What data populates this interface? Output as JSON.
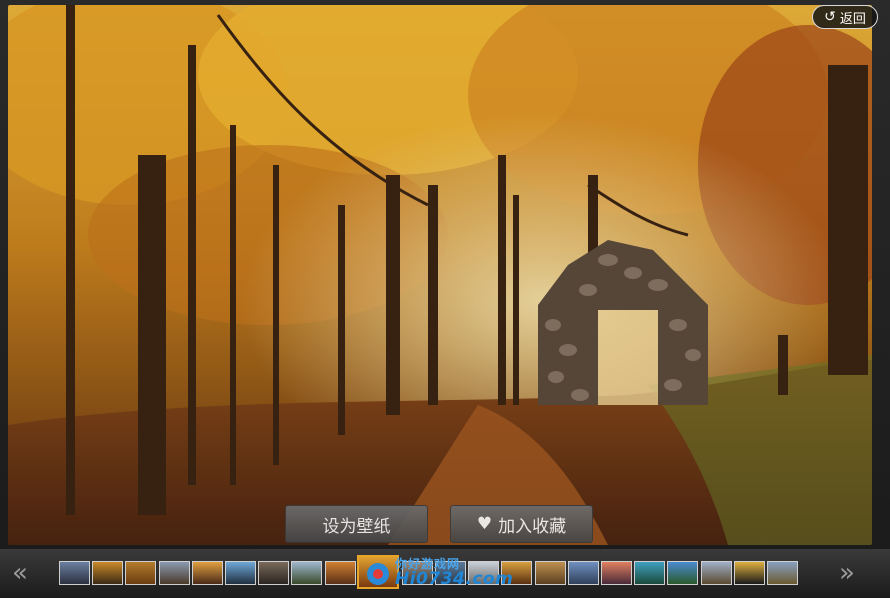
{
  "viewer": {
    "back_label": "返回",
    "back_icon": "undo-arrow-icon"
  },
  "actions": {
    "set_wallpaper_label": "设为壁纸",
    "favorite_label": "加入收藏",
    "favorite_icon": "heart-icon"
  },
  "thumbnail_strip": {
    "prev_icon": "double-left-chevron-icon",
    "next_icon": "double-right-chevron-icon",
    "prev_glyph": "«",
    "next_glyph": "»",
    "thumbnails": [
      {
        "color_top": "#6b7fa0",
        "color_bottom": "#2c3140"
      },
      {
        "color_top": "#c98a2a",
        "color_bottom": "#3c2a14"
      },
      {
        "color_top": "#b37b2c",
        "color_bottom": "#6b3d12"
      },
      {
        "color_top": "#8a9bb0",
        "color_bottom": "#4b3a2a"
      },
      {
        "color_top": "#e0a040",
        "color_bottom": "#4a2a18"
      },
      {
        "color_top": "#6ea8d8",
        "color_bottom": "#203040"
      },
      {
        "color_top": "#7a6a5a",
        "color_bottom": "#2a2420"
      },
      {
        "color_top": "#a0b8d0",
        "color_bottom": "#3a4a2a"
      },
      {
        "color_top": "#d08030",
        "color_bottom": "#5a3018"
      },
      {
        "color_top": "#e0a030",
        "color_bottom": "#7a3a10",
        "active": true
      },
      {
        "color_top": "#9a8a7a",
        "color_bottom": "#3a3a3a"
      },
      {
        "color_top": "#5a7a9a",
        "color_bottom": "#2a3a4a"
      },
      {
        "color_top": "#c8d0d8",
        "color_bottom": "#6a6a6a"
      },
      {
        "color_top": "#d8a040",
        "color_bottom": "#5a3010"
      },
      {
        "color_top": "#c09050",
        "color_bottom": "#5a4020"
      },
      {
        "color_top": "#7090c0",
        "color_bottom": "#30405a"
      },
      {
        "color_top": "#e08060",
        "color_bottom": "#4a2a3a"
      },
      {
        "color_top": "#40a0c0",
        "color_bottom": "#1a4a3a"
      },
      {
        "color_top": "#4a8ad0",
        "color_bottom": "#2a5a2a"
      },
      {
        "color_top": "#a0b0c8",
        "color_bottom": "#5a4a30"
      },
      {
        "color_top": "#e0b040",
        "color_bottom": "#1a1a1a"
      },
      {
        "color_top": "#8aa0c0",
        "color_bottom": "#6a5a30"
      }
    ]
  },
  "watermark": {
    "line1": "你好游戏网",
    "line2": "Hi0734.com"
  }
}
